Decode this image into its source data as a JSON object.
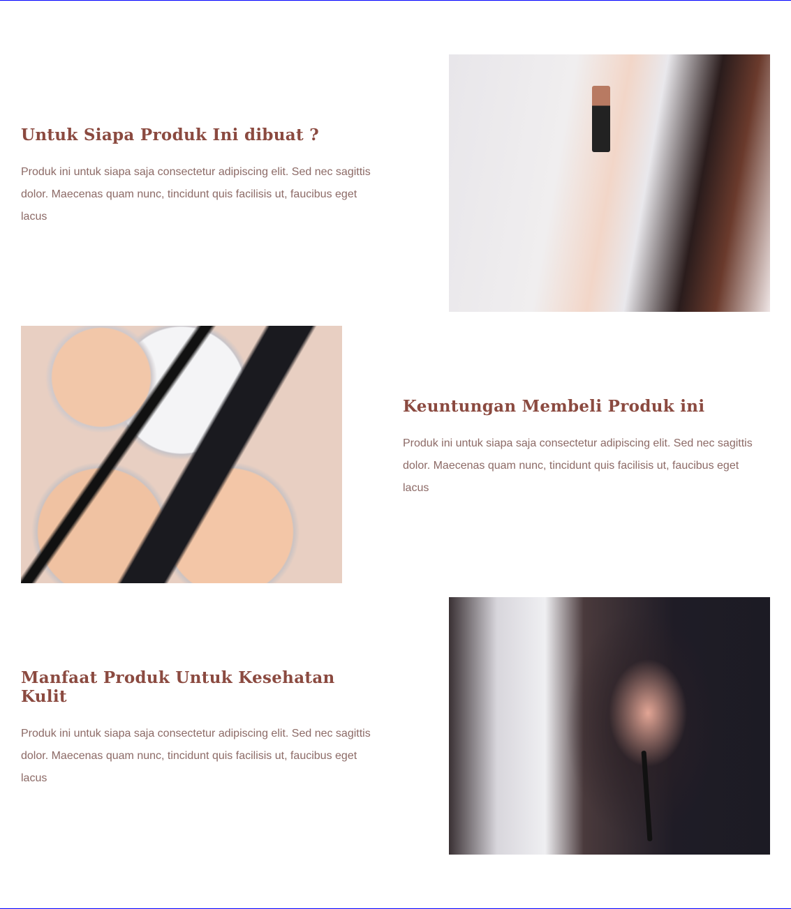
{
  "sections": [
    {
      "title": "Untuk Siapa Produk Ini dibuat ?",
      "body": "Produk ini untuk siapa saja consectetur adipiscing elit. Sed nec sagittis dolor. Maecenas quam nunc, tincidunt quis facilisis ut, faucibus eget lacus",
      "image": "woman-holding-lipstick"
    },
    {
      "title": "Keuntungan Membeli Produk ini",
      "body": "Produk ini untuk siapa saja consectetur adipiscing elit. Sed nec sagittis dolor. Maecenas quam nunc, tincidunt quis facilisis ut, faucibus eget lacus",
      "image": "makeup-powder-and-brushes"
    },
    {
      "title": "Manfaat Produk Untuk Kesehatan Kulit",
      "body": "Produk ini untuk siapa saja consectetur adipiscing elit. Sed nec sagittis dolor. Maecenas quam nunc, tincidunt quis facilisis ut, faucibus eget lacus",
      "image": "woman-applying-makeup-brush"
    }
  ],
  "colors": {
    "heading": "#8b4a40",
    "body": "#8c6a66",
    "border": "#0000ff"
  }
}
